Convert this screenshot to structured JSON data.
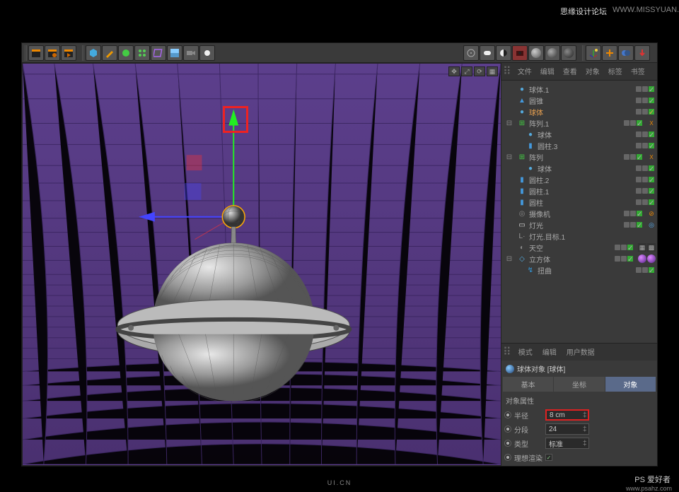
{
  "watermark_left": "思缘设计论坛",
  "watermark_right": "WWW.MISSYUAN.COM",
  "footer_logo": "UI.CN",
  "footer_text": "PS 爱好者",
  "footer_url": "www.psahz.com",
  "object_tabs": [
    "文件",
    "编辑",
    "查看",
    "对象",
    "标签",
    "书签"
  ],
  "hierarchy": [
    {
      "icon": "●",
      "color": "#5ad",
      "name": "球体.1",
      "sel": false,
      "indent": 0,
      "dots": true,
      "tags": []
    },
    {
      "icon": "▲",
      "color": "#49d",
      "name": "圆锥",
      "sel": false,
      "indent": 0,
      "dots": true,
      "tags": []
    },
    {
      "icon": "●",
      "color": "#5ad",
      "name": "球体",
      "sel": true,
      "indent": 0,
      "dots": true,
      "tags": []
    },
    {
      "icon": "⊞",
      "color": "#4c4",
      "name": "阵列.1",
      "sel": false,
      "indent": 0,
      "dots": true,
      "exp": "⊟",
      "tags": [
        "X"
      ]
    },
    {
      "icon": "●",
      "color": "#5ad",
      "name": "球体",
      "sel": false,
      "indent": 1,
      "dots": true,
      "tags": []
    },
    {
      "icon": "▮",
      "color": "#49d",
      "name": "圆柱.3",
      "sel": false,
      "indent": 1,
      "dots": true,
      "tags": []
    },
    {
      "icon": "⊞",
      "color": "#4c4",
      "name": "阵列",
      "sel": false,
      "indent": 0,
      "dots": true,
      "exp": "⊟",
      "tags": [
        "X"
      ]
    },
    {
      "icon": "●",
      "color": "#5ad",
      "name": "球体",
      "sel": false,
      "indent": 1,
      "dots": true,
      "tags": []
    },
    {
      "icon": "▮",
      "color": "#49d",
      "name": "圆柱.2",
      "sel": false,
      "indent": 0,
      "dots": true,
      "tags": []
    },
    {
      "icon": "▮",
      "color": "#49d",
      "name": "圆柱.1",
      "sel": false,
      "indent": 0,
      "dots": true,
      "tags": []
    },
    {
      "icon": "▮",
      "color": "#49d",
      "name": "圆柱",
      "sel": false,
      "indent": 0,
      "dots": true,
      "tags": []
    },
    {
      "icon": "◎",
      "color": "#888",
      "name": "摄像机",
      "sel": false,
      "indent": 0,
      "dots": true,
      "tags": [
        "⊘"
      ]
    },
    {
      "icon": "▭",
      "color": "#ddd",
      "name": "灯光",
      "sel": false,
      "indent": 0,
      "dots": true,
      "tags": [
        "◎"
      ]
    },
    {
      "icon": "L·",
      "color": "#999",
      "name": "灯光.目标.1",
      "sel": false,
      "indent": 0,
      "dots": false,
      "tags": []
    },
    {
      "icon": "◐",
      "color": "#888",
      "name": "天空",
      "sel": false,
      "indent": 0,
      "dots": true,
      "tags": [
        "▦",
        "▩"
      ]
    },
    {
      "icon": "◇",
      "color": "#5ad",
      "name": "立方体",
      "sel": false,
      "indent": 0,
      "dots": true,
      "exp": "⊟",
      "tags": [
        "●",
        "●"
      ]
    },
    {
      "icon": "↯",
      "color": "#39d",
      "name": "扭曲",
      "sel": false,
      "indent": 1,
      "dots": true,
      "tags": []
    }
  ],
  "attr_tabs": [
    "模式",
    "编辑",
    "用户数据"
  ],
  "attr_title": "球体对象 [球体]",
  "attr_subtabs": [
    {
      "label": "基本",
      "active": false
    },
    {
      "label": "坐标",
      "active": false
    },
    {
      "label": "对象",
      "active": true
    }
  ],
  "attr_section_title": "对象属性",
  "attr_rows": [
    {
      "type": "num",
      "label": "半径",
      "value": "8 cm",
      "hl": true
    },
    {
      "type": "num",
      "label": "分段",
      "value": "24",
      "hl": false
    },
    {
      "type": "sel",
      "label": "类型",
      "value": "标准",
      "hl": false
    },
    {
      "type": "chk",
      "label": "理想渲染",
      "value": "✓",
      "hl": false
    }
  ]
}
